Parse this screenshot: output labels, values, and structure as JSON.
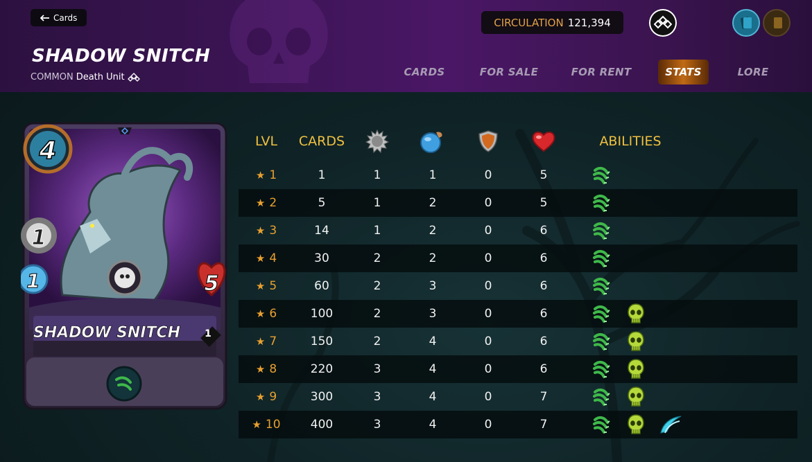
{
  "header": {
    "back_label": "Cards",
    "title": "SHADOW SNITCH",
    "rarity": "COMMON",
    "type_label": "Death Unit",
    "circulation_label": "CIRCULATION",
    "circulation_value": "121,394"
  },
  "nav": [
    "CARDS",
    "FOR SALE",
    "FOR RENT",
    "STATS",
    "LORE"
  ],
  "active_tab": "STATS",
  "card": {
    "name": "SHADOW SNITCH",
    "mana": "4",
    "attack": "1",
    "speed": "1",
    "health": "5",
    "level": "1",
    "ability_icon": "claw-icon",
    "element": "death"
  },
  "table": {
    "headers": {
      "lvl": "LVL",
      "cards": "CARDS",
      "attack_icon": "melee-attack-icon",
      "speed_icon": "speed-icon",
      "armor_icon": "armor-shield-icon",
      "health_icon": "health-heart-icon",
      "abilities": "ABILITIES"
    },
    "rows": [
      {
        "lvl": "1",
        "cards": "1",
        "attack": "1",
        "speed": "1",
        "armor": "0",
        "health": "5",
        "abilities": [
          "claw-icon"
        ]
      },
      {
        "lvl": "2",
        "cards": "5",
        "attack": "1",
        "speed": "2",
        "armor": "0",
        "health": "5",
        "abilities": [
          "claw-icon"
        ]
      },
      {
        "lvl": "3",
        "cards": "14",
        "attack": "1",
        "speed": "2",
        "armor": "0",
        "health": "6",
        "abilities": [
          "claw-icon"
        ]
      },
      {
        "lvl": "4",
        "cards": "30",
        "attack": "2",
        "speed": "2",
        "armor": "0",
        "health": "6",
        "abilities": [
          "claw-icon"
        ]
      },
      {
        "lvl": "5",
        "cards": "60",
        "attack": "2",
        "speed": "3",
        "armor": "0",
        "health": "6",
        "abilities": [
          "claw-icon"
        ]
      },
      {
        "lvl": "6",
        "cards": "100",
        "attack": "2",
        "speed": "3",
        "armor": "0",
        "health": "6",
        "abilities": [
          "claw-icon",
          "skull-icon"
        ]
      },
      {
        "lvl": "7",
        "cards": "150",
        "attack": "2",
        "speed": "4",
        "armor": "0",
        "health": "6",
        "abilities": [
          "claw-icon",
          "skull-icon"
        ]
      },
      {
        "lvl": "8",
        "cards": "220",
        "attack": "3",
        "speed": "4",
        "armor": "0",
        "health": "6",
        "abilities": [
          "claw-icon",
          "skull-icon"
        ]
      },
      {
        "lvl": "9",
        "cards": "300",
        "attack": "3",
        "speed": "4",
        "armor": "0",
        "health": "7",
        "abilities": [
          "claw-icon",
          "skull-icon"
        ]
      },
      {
        "lvl": "10",
        "cards": "400",
        "attack": "3",
        "speed": "4",
        "armor": "0",
        "health": "7",
        "abilities": [
          "claw-icon",
          "skull-icon",
          "scythe-icon"
        ]
      }
    ]
  },
  "colors": {
    "accent_gold": "#f0c040",
    "level_orange": "#e8a030",
    "claw_green": "#3fb84a",
    "skull_lime": "#b5d93a",
    "scythe_cyan": "#3fd0e8"
  }
}
